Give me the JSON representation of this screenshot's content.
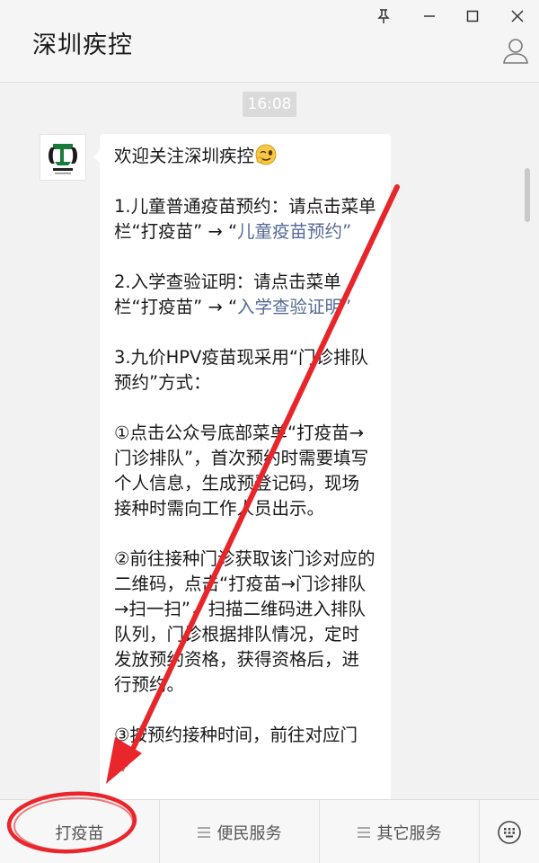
{
  "window": {
    "title": "深圳疾控"
  },
  "chat": {
    "timestamp": "16:08",
    "message": {
      "greeting": "欢迎关注深圳疾控",
      "p1_text": "1.儿童普通疫苗预约：请点击菜单栏“打疫苗” → “",
      "p1_link": "儿童疫苗预约",
      "p1_end": "”",
      "p2_text": "2.入学查验证明：请点击菜单栏“打疫苗” → “",
      "p2_link": "入学查验证明",
      "p2_end": "”",
      "p3": "3.九价HPV疫苗现采用“门诊排队预约”方式：",
      "p4": "①点击公众号底部菜单“打疫苗→门诊排队”，首次预约时需要填写个人信息，生成预登记码，现场接种时需向工作人员出示。",
      "p5": "②前往接种门诊获取该门诊对应的二维码，点击“打疫苗→门诊排队→扫一扫”，扫描二维码进入排队队列，门诊根据排队情况，定时发放预约资格，获得资格后，进行预约。",
      "p6": "③按预约接种时间，前往对应门"
    }
  },
  "menu": {
    "item1": "打疫苗",
    "item2": "便民服务",
    "item3": "其它服务"
  },
  "colors": {
    "link": "#576b95",
    "annotation": "#e8262b"
  }
}
